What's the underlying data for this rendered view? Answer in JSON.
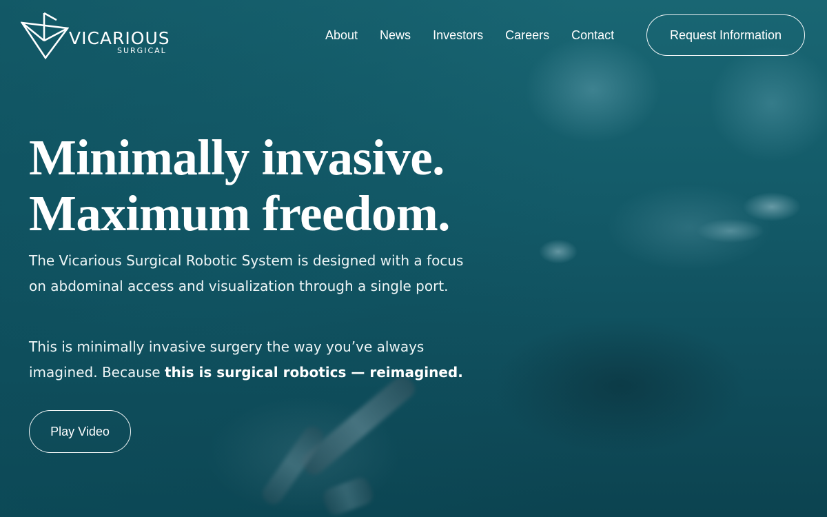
{
  "brand": {
    "name": "VICARIOUS",
    "subname": "SURGICAL"
  },
  "nav": {
    "items": [
      {
        "label": "About"
      },
      {
        "label": "News"
      },
      {
        "label": "Investors"
      },
      {
        "label": "Careers"
      },
      {
        "label": "Contact"
      }
    ],
    "cta_label": "Request Information"
  },
  "hero": {
    "headline_line1": "Minimally invasive.",
    "headline_line2": "Maximum freedom.",
    "paragraph1": "The Vicarious Surgical Robotic System is designed with a focus on abdominal access and visualization through a single port.",
    "paragraph2_lead": "This is minimally invasive surgery the way you’ve always imagined. Because ",
    "paragraph2_bold": "this is surgical robotics — reimagined.",
    "play_label": "Play Video",
    "background": "blurred-surgical-scene-image"
  },
  "colors": {
    "background": "#135a68",
    "text": "#ffffff"
  }
}
